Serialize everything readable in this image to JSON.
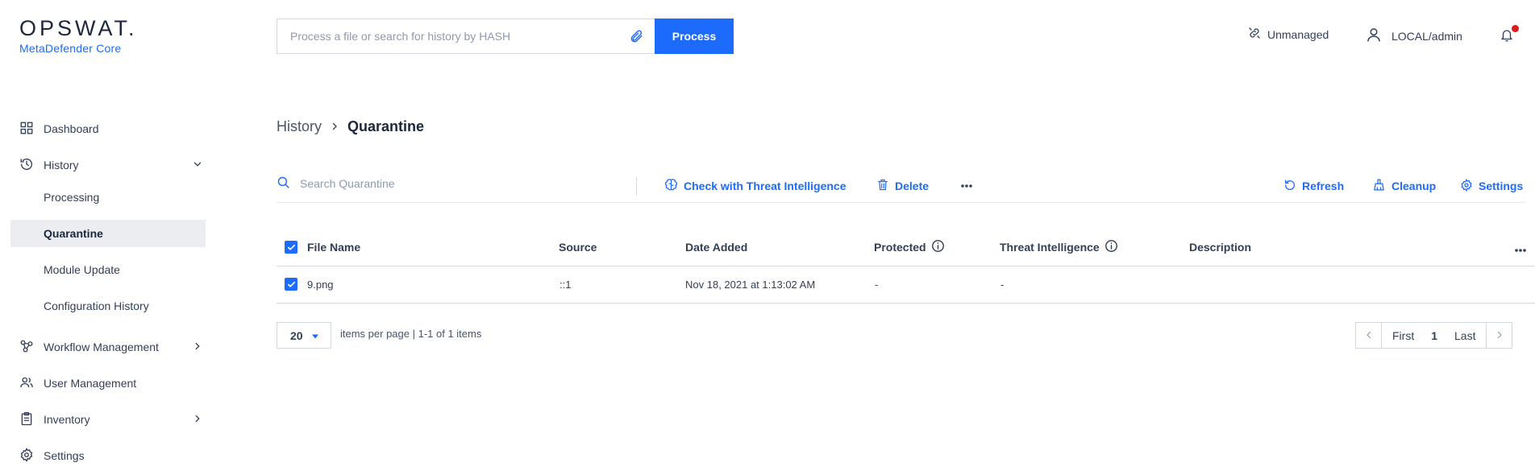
{
  "brand": {
    "name": "OPSWAT.",
    "product": "MetaDefender Core"
  },
  "top_search": {
    "placeholder": "Process a file or search for history by HASH",
    "button": "Process"
  },
  "header": {
    "unmanaged": "Unmanaged",
    "user": "LOCAL/admin"
  },
  "sidebar": {
    "dashboard": "Dashboard",
    "history": "History",
    "history_sub": [
      "Processing",
      "Quarantine",
      "Module Update",
      "Configuration History"
    ],
    "workflow": "Workflow Management",
    "users": "User Management",
    "inventory": "Inventory",
    "settings": "Settings"
  },
  "breadcrumb": {
    "parent": "History",
    "current": "Quarantine"
  },
  "toolbar": {
    "search_placeholder": "Search Quarantine",
    "threat_intel": "Check with Threat Intelligence",
    "delete": "Delete",
    "refresh": "Refresh",
    "cleanup": "Cleanup",
    "settings": "Settings"
  },
  "table": {
    "headers": {
      "file_name": "File Name",
      "source": "Source",
      "date_added": "Date Added",
      "protected": "Protected",
      "threat_intel": "Threat Intelligence",
      "description": "Description"
    },
    "rows": [
      {
        "file_name": "9.png",
        "source": "::1",
        "date_added": "Nov 18, 2021 at 1:13:02 AM",
        "protected": "-",
        "threat_intel": "-",
        "description": ""
      }
    ]
  },
  "pagination": {
    "per_page": "20",
    "info": "items per page | 1-1 of 1 items",
    "first": "First",
    "page": "1",
    "last": "Last"
  },
  "colors": {
    "accent": "#1d6bfc",
    "text": "#313f57",
    "active_bg": "#ebedf1",
    "alert": "#e11b1b"
  }
}
